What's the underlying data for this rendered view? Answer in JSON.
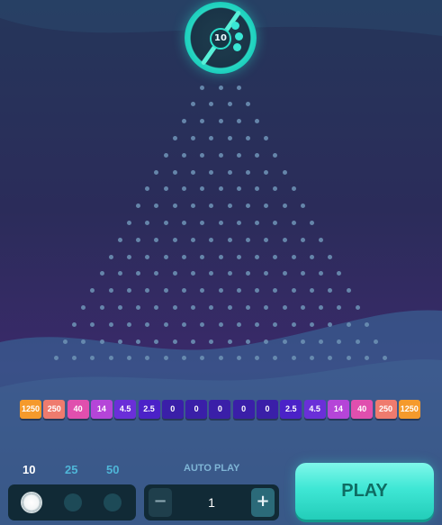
{
  "launcher": {
    "balls_remaining": "10"
  },
  "multipliers": [
    "1250",
    "250",
    "40",
    "14",
    "4.5",
    "2.5",
    "0",
    "0",
    "0",
    "0",
    "0",
    "2.5",
    "4.5",
    "14",
    "40",
    "250",
    "1250"
  ],
  "multiplier_colors": [
    "#f59a2c",
    "#ef7b6e",
    "#e04fae",
    "#b545d8",
    "#6a2fd8",
    "#4b22c8",
    "#3a1fa8",
    "#3a1fa8",
    "#3a1fa8",
    "#3a1fa8",
    "#3a1fa8",
    "#4b22c8",
    "#6a2fd8",
    "#b545d8",
    "#e04fae",
    "#ef7b6e",
    "#f59a2c"
  ],
  "ball_count_options": [
    {
      "label": "10",
      "color": "#ffffff"
    },
    {
      "label": "25",
      "color": "#4fb6d8"
    },
    {
      "label": "50",
      "color": "#4fb6d8"
    }
  ],
  "autoplay": {
    "label": "AUTO PLAY",
    "value": "1",
    "minus_label": "−",
    "plus_label": "+"
  },
  "play_button": {
    "label": "PLAY"
  },
  "colors": {
    "accent": "#3fe7d5",
    "peg": "#6b8fb3",
    "panel": "#112a36"
  }
}
